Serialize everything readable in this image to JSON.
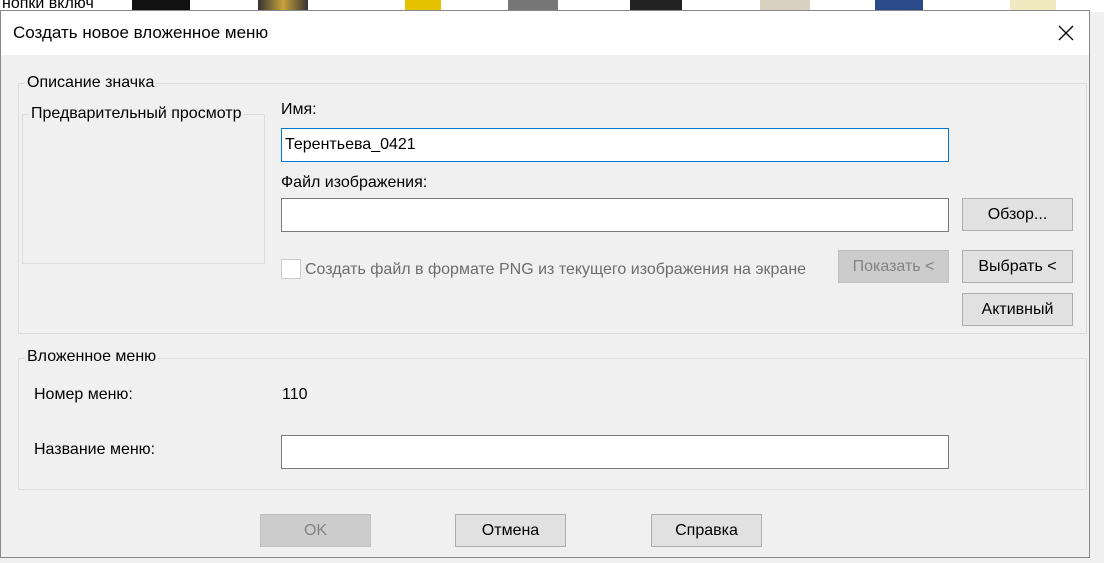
{
  "background": {
    "partial_text": "нопки включ"
  },
  "dialog": {
    "title": "Создать новое вложенное меню",
    "icon_group": {
      "legend": "Описание значка",
      "preview_label": "Предварительный просмотр",
      "name_label": "Имя:",
      "name_value": "Терентьева_0421",
      "image_file_label": "Файл изображения:",
      "image_file_value": "",
      "browse_button": "Обзор...",
      "png_checkbox_label": "Создать файл в формате PNG из текущего изображения на экране",
      "png_checkbox_checked": false,
      "show_button": "Показать <",
      "select_button": "Выбрать <",
      "active_button": "Активный"
    },
    "submenu_group": {
      "legend": "Вложенное меню",
      "menu_number_label": "Номер меню:",
      "menu_number_value": "110",
      "menu_name_label": "Название меню:",
      "menu_name_value": ""
    },
    "footer": {
      "ok_button": "OK",
      "cancel_button": "Отмена",
      "help_button": "Справка"
    }
  }
}
